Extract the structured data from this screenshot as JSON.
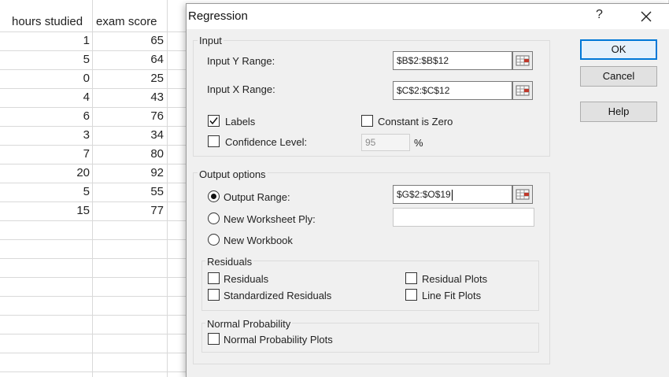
{
  "spreadsheet": {
    "headers": [
      "hours studied",
      "exam score"
    ],
    "rows": [
      [
        "1",
        "65"
      ],
      [
        "5",
        "64"
      ],
      [
        "0",
        "25"
      ],
      [
        "4",
        "43"
      ],
      [
        "6",
        "76"
      ],
      [
        "3",
        "34"
      ],
      [
        "7",
        "80"
      ],
      [
        "20",
        "92"
      ],
      [
        "5",
        "55"
      ],
      [
        "15",
        "77"
      ]
    ]
  },
  "dialog": {
    "title": "Regression",
    "help_glyph": "?",
    "input": {
      "legend": "Input",
      "y_range_label": "Input Y Range:",
      "y_range_value": "$B$2:$B$12",
      "x_range_label": "Input X Range:",
      "x_range_value": "$C$2:$C$12",
      "labels_label": "Labels",
      "labels_checked": true,
      "constant_zero_label": "Constant is Zero",
      "constant_zero_checked": false,
      "confidence_label": "Confidence Level:",
      "confidence_checked": false,
      "confidence_value": "95",
      "confidence_unit": "%"
    },
    "output": {
      "legend": "Output options",
      "output_range_label": "Output Range:",
      "output_range_value": "$G$2:$O$19",
      "new_worksheet_label": "New Worksheet Ply:",
      "new_worksheet_value": "",
      "new_workbook_label": "New Workbook",
      "selected": "output_range",
      "residuals": {
        "legend": "Residuals",
        "residuals_label": "Residuals",
        "standardized_label": "Standardized Residuals",
        "residual_plots_label": "Residual Plots",
        "line_fit_label": "Line Fit Plots"
      },
      "normal_probability": {
        "legend": "Normal Probability",
        "plots_label": "Normal Probability Plots"
      }
    },
    "buttons": {
      "ok": "OK",
      "cancel": "Cancel",
      "help": "Help"
    }
  },
  "icons": {
    "range_selector": "range-selector-icon",
    "close": "close-icon",
    "checkmark": "checkmark-icon"
  },
  "colors": {
    "dialog_bg": "#f0f0f0",
    "default_button_border": "#0078d7",
    "gridline": "#d9d9d9"
  }
}
